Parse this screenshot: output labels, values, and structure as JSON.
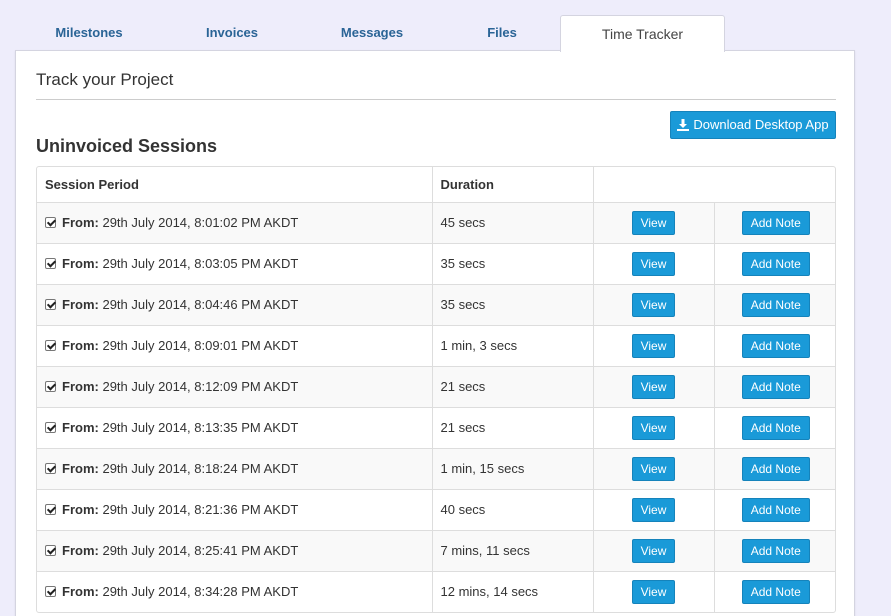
{
  "tabs": [
    {
      "label": "Milestones",
      "active": false
    },
    {
      "label": "Invoices",
      "active": false
    },
    {
      "label": "Messages",
      "active": false
    },
    {
      "label": "Files",
      "active": false
    },
    {
      "label": "Time Tracker",
      "active": true
    }
  ],
  "panel": {
    "title": "Track your Project",
    "download_button": "Download Desktop App",
    "section_title": "Uninvoiced Sessions"
  },
  "table": {
    "headers": [
      "Session Period",
      "Duration",
      ""
    ],
    "from_label": "From:",
    "view_label": "View",
    "note_label": "Add Note",
    "rows": [
      {
        "period": "29th July 2014, 8:01:02 PM AKDT",
        "duration": "45 secs",
        "checked": true
      },
      {
        "period": "29th July 2014, 8:03:05 PM AKDT",
        "duration": "35 secs",
        "checked": true
      },
      {
        "period": "29th July 2014, 8:04:46 PM AKDT",
        "duration": "35 secs",
        "checked": true
      },
      {
        "period": "29th July 2014, 8:09:01 PM AKDT",
        "duration": "1 min, 3 secs",
        "checked": true
      },
      {
        "period": "29th July 2014, 8:12:09 PM AKDT",
        "duration": "21 secs",
        "checked": true
      },
      {
        "period": "29th July 2014, 8:13:35 PM AKDT",
        "duration": "21 secs",
        "checked": true
      },
      {
        "period": "29th July 2014, 8:18:24 PM AKDT",
        "duration": "1 min, 15 secs",
        "checked": true
      },
      {
        "period": "29th July 2014, 8:21:36 PM AKDT",
        "duration": "40 secs",
        "checked": true
      },
      {
        "period": "29th July 2014, 8:25:41 PM AKDT",
        "duration": "7 mins, 11 secs",
        "checked": true
      },
      {
        "period": "29th July 2014, 8:34:28 PM AKDT",
        "duration": "12 mins, 14 secs",
        "checked": true
      }
    ]
  },
  "colors": {
    "accent": "#1a9ad8",
    "tab_text": "#2a6496",
    "page_bg": "#eeedfb"
  }
}
